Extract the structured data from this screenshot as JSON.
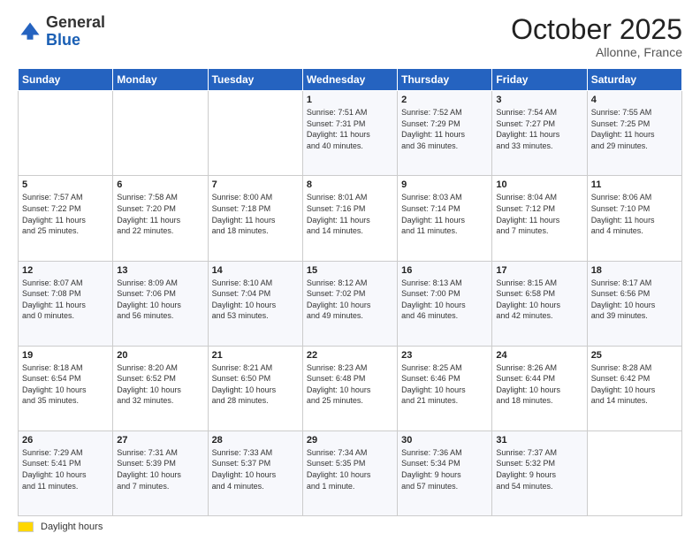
{
  "header": {
    "logo_general": "General",
    "logo_blue": "Blue",
    "month_title": "October 2025",
    "subtitle": "Allonne, France"
  },
  "days_of_week": [
    "Sunday",
    "Monday",
    "Tuesday",
    "Wednesday",
    "Thursday",
    "Friday",
    "Saturday"
  ],
  "weeks": [
    [
      {
        "day": "",
        "info": ""
      },
      {
        "day": "",
        "info": ""
      },
      {
        "day": "",
        "info": ""
      },
      {
        "day": "1",
        "info": "Sunrise: 7:51 AM\nSunset: 7:31 PM\nDaylight: 11 hours\nand 40 minutes."
      },
      {
        "day": "2",
        "info": "Sunrise: 7:52 AM\nSunset: 7:29 PM\nDaylight: 11 hours\nand 36 minutes."
      },
      {
        "day": "3",
        "info": "Sunrise: 7:54 AM\nSunset: 7:27 PM\nDaylight: 11 hours\nand 33 minutes."
      },
      {
        "day": "4",
        "info": "Sunrise: 7:55 AM\nSunset: 7:25 PM\nDaylight: 11 hours\nand 29 minutes."
      }
    ],
    [
      {
        "day": "5",
        "info": "Sunrise: 7:57 AM\nSunset: 7:22 PM\nDaylight: 11 hours\nand 25 minutes."
      },
      {
        "day": "6",
        "info": "Sunrise: 7:58 AM\nSunset: 7:20 PM\nDaylight: 11 hours\nand 22 minutes."
      },
      {
        "day": "7",
        "info": "Sunrise: 8:00 AM\nSunset: 7:18 PM\nDaylight: 11 hours\nand 18 minutes."
      },
      {
        "day": "8",
        "info": "Sunrise: 8:01 AM\nSunset: 7:16 PM\nDaylight: 11 hours\nand 14 minutes."
      },
      {
        "day": "9",
        "info": "Sunrise: 8:03 AM\nSunset: 7:14 PM\nDaylight: 11 hours\nand 11 minutes."
      },
      {
        "day": "10",
        "info": "Sunrise: 8:04 AM\nSunset: 7:12 PM\nDaylight: 11 hours\nand 7 minutes."
      },
      {
        "day": "11",
        "info": "Sunrise: 8:06 AM\nSunset: 7:10 PM\nDaylight: 11 hours\nand 4 minutes."
      }
    ],
    [
      {
        "day": "12",
        "info": "Sunrise: 8:07 AM\nSunset: 7:08 PM\nDaylight: 11 hours\nand 0 minutes."
      },
      {
        "day": "13",
        "info": "Sunrise: 8:09 AM\nSunset: 7:06 PM\nDaylight: 10 hours\nand 56 minutes."
      },
      {
        "day": "14",
        "info": "Sunrise: 8:10 AM\nSunset: 7:04 PM\nDaylight: 10 hours\nand 53 minutes."
      },
      {
        "day": "15",
        "info": "Sunrise: 8:12 AM\nSunset: 7:02 PM\nDaylight: 10 hours\nand 49 minutes."
      },
      {
        "day": "16",
        "info": "Sunrise: 8:13 AM\nSunset: 7:00 PM\nDaylight: 10 hours\nand 46 minutes."
      },
      {
        "day": "17",
        "info": "Sunrise: 8:15 AM\nSunset: 6:58 PM\nDaylight: 10 hours\nand 42 minutes."
      },
      {
        "day": "18",
        "info": "Sunrise: 8:17 AM\nSunset: 6:56 PM\nDaylight: 10 hours\nand 39 minutes."
      }
    ],
    [
      {
        "day": "19",
        "info": "Sunrise: 8:18 AM\nSunset: 6:54 PM\nDaylight: 10 hours\nand 35 minutes."
      },
      {
        "day": "20",
        "info": "Sunrise: 8:20 AM\nSunset: 6:52 PM\nDaylight: 10 hours\nand 32 minutes."
      },
      {
        "day": "21",
        "info": "Sunrise: 8:21 AM\nSunset: 6:50 PM\nDaylight: 10 hours\nand 28 minutes."
      },
      {
        "day": "22",
        "info": "Sunrise: 8:23 AM\nSunset: 6:48 PM\nDaylight: 10 hours\nand 25 minutes."
      },
      {
        "day": "23",
        "info": "Sunrise: 8:25 AM\nSunset: 6:46 PM\nDaylight: 10 hours\nand 21 minutes."
      },
      {
        "day": "24",
        "info": "Sunrise: 8:26 AM\nSunset: 6:44 PM\nDaylight: 10 hours\nand 18 minutes."
      },
      {
        "day": "25",
        "info": "Sunrise: 8:28 AM\nSunset: 6:42 PM\nDaylight: 10 hours\nand 14 minutes."
      }
    ],
    [
      {
        "day": "26",
        "info": "Sunrise: 7:29 AM\nSunset: 5:41 PM\nDaylight: 10 hours\nand 11 minutes."
      },
      {
        "day": "27",
        "info": "Sunrise: 7:31 AM\nSunset: 5:39 PM\nDaylight: 10 hours\nand 7 minutes."
      },
      {
        "day": "28",
        "info": "Sunrise: 7:33 AM\nSunset: 5:37 PM\nDaylight: 10 hours\nand 4 minutes."
      },
      {
        "day": "29",
        "info": "Sunrise: 7:34 AM\nSunset: 5:35 PM\nDaylight: 10 hours\nand 1 minute."
      },
      {
        "day": "30",
        "info": "Sunrise: 7:36 AM\nSunset: 5:34 PM\nDaylight: 9 hours\nand 57 minutes."
      },
      {
        "day": "31",
        "info": "Sunrise: 7:37 AM\nSunset: 5:32 PM\nDaylight: 9 hours\nand 54 minutes."
      },
      {
        "day": "",
        "info": ""
      }
    ]
  ],
  "footer": {
    "legend_label": "Daylight hours"
  }
}
